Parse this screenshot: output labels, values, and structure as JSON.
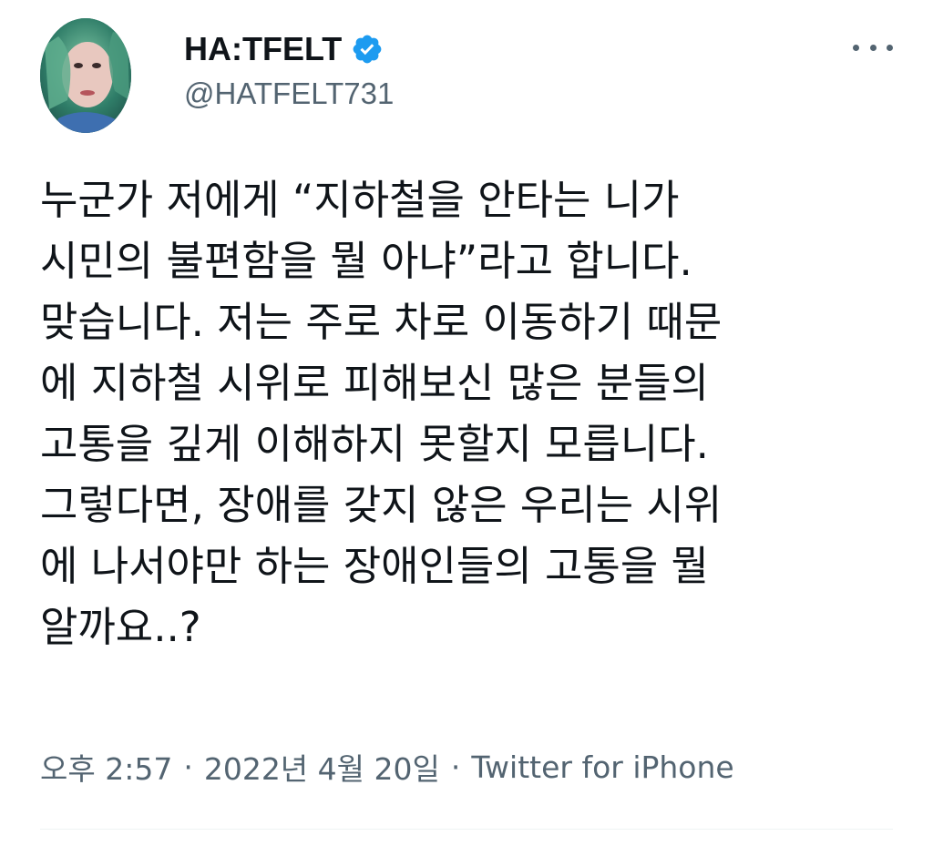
{
  "user": {
    "display_name": "HA:TFELT",
    "handle": "@HATFELT731",
    "verified": true,
    "avatar_icon": "profile-photo",
    "verified_icon": "verified-badge-icon",
    "verified_color": "#1d9bf0"
  },
  "more_icon": "more-horizontal-icon",
  "tweet": {
    "lines": [
      "누군가 저에게 “지하철을 안타는 니가",
      "시민의 불편함을 뭘 아냐”라고 합니다.",
      "맞습니다. 저는 주로 차로 이동하기 때문",
      "에 지하철 시위로 피해보신 많은 분들의",
      "고통을 깊게 이해하지 못할지 모릅니다.",
      "그렇다면, 장애를 갖지 않은 우리는 시위",
      "에 나서야만 하는 장애인들의 고통을 뭘",
      "알까요..?"
    ]
  },
  "meta": {
    "time": "오후 2:57",
    "separator": "·",
    "date": "2022년 4월 20일",
    "source": "Twitter for iPhone"
  },
  "colors": {
    "text": "#0f1419",
    "secondary": "#536471",
    "divider": "#eff3f4"
  }
}
